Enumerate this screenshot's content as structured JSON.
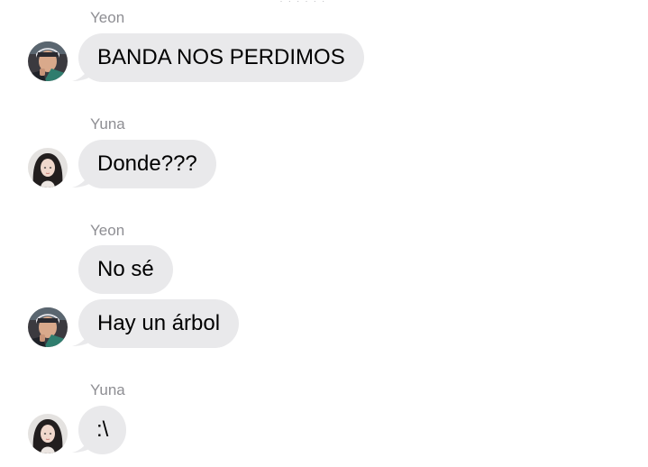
{
  "colors": {
    "background": "#ffffff",
    "bubble_incoming": "#e9e9eb",
    "sender_name": "#8e8e93",
    "message_text": "#000000"
  },
  "messages": [
    {
      "sender": "Yeon",
      "text": "BANDA NOS PERDIMOS",
      "avatar": "yeon-avatar"
    },
    {
      "sender": "Yuna",
      "text": "Donde???",
      "avatar": "yuna-avatar"
    },
    {
      "sender": "Yeon",
      "text": "No sé"
    },
    {
      "text": "Hay un árbol",
      "avatar": "yeon-avatar"
    },
    {
      "sender": "Yuna",
      "text": ":\\",
      "avatar": "yuna-avatar"
    }
  ]
}
